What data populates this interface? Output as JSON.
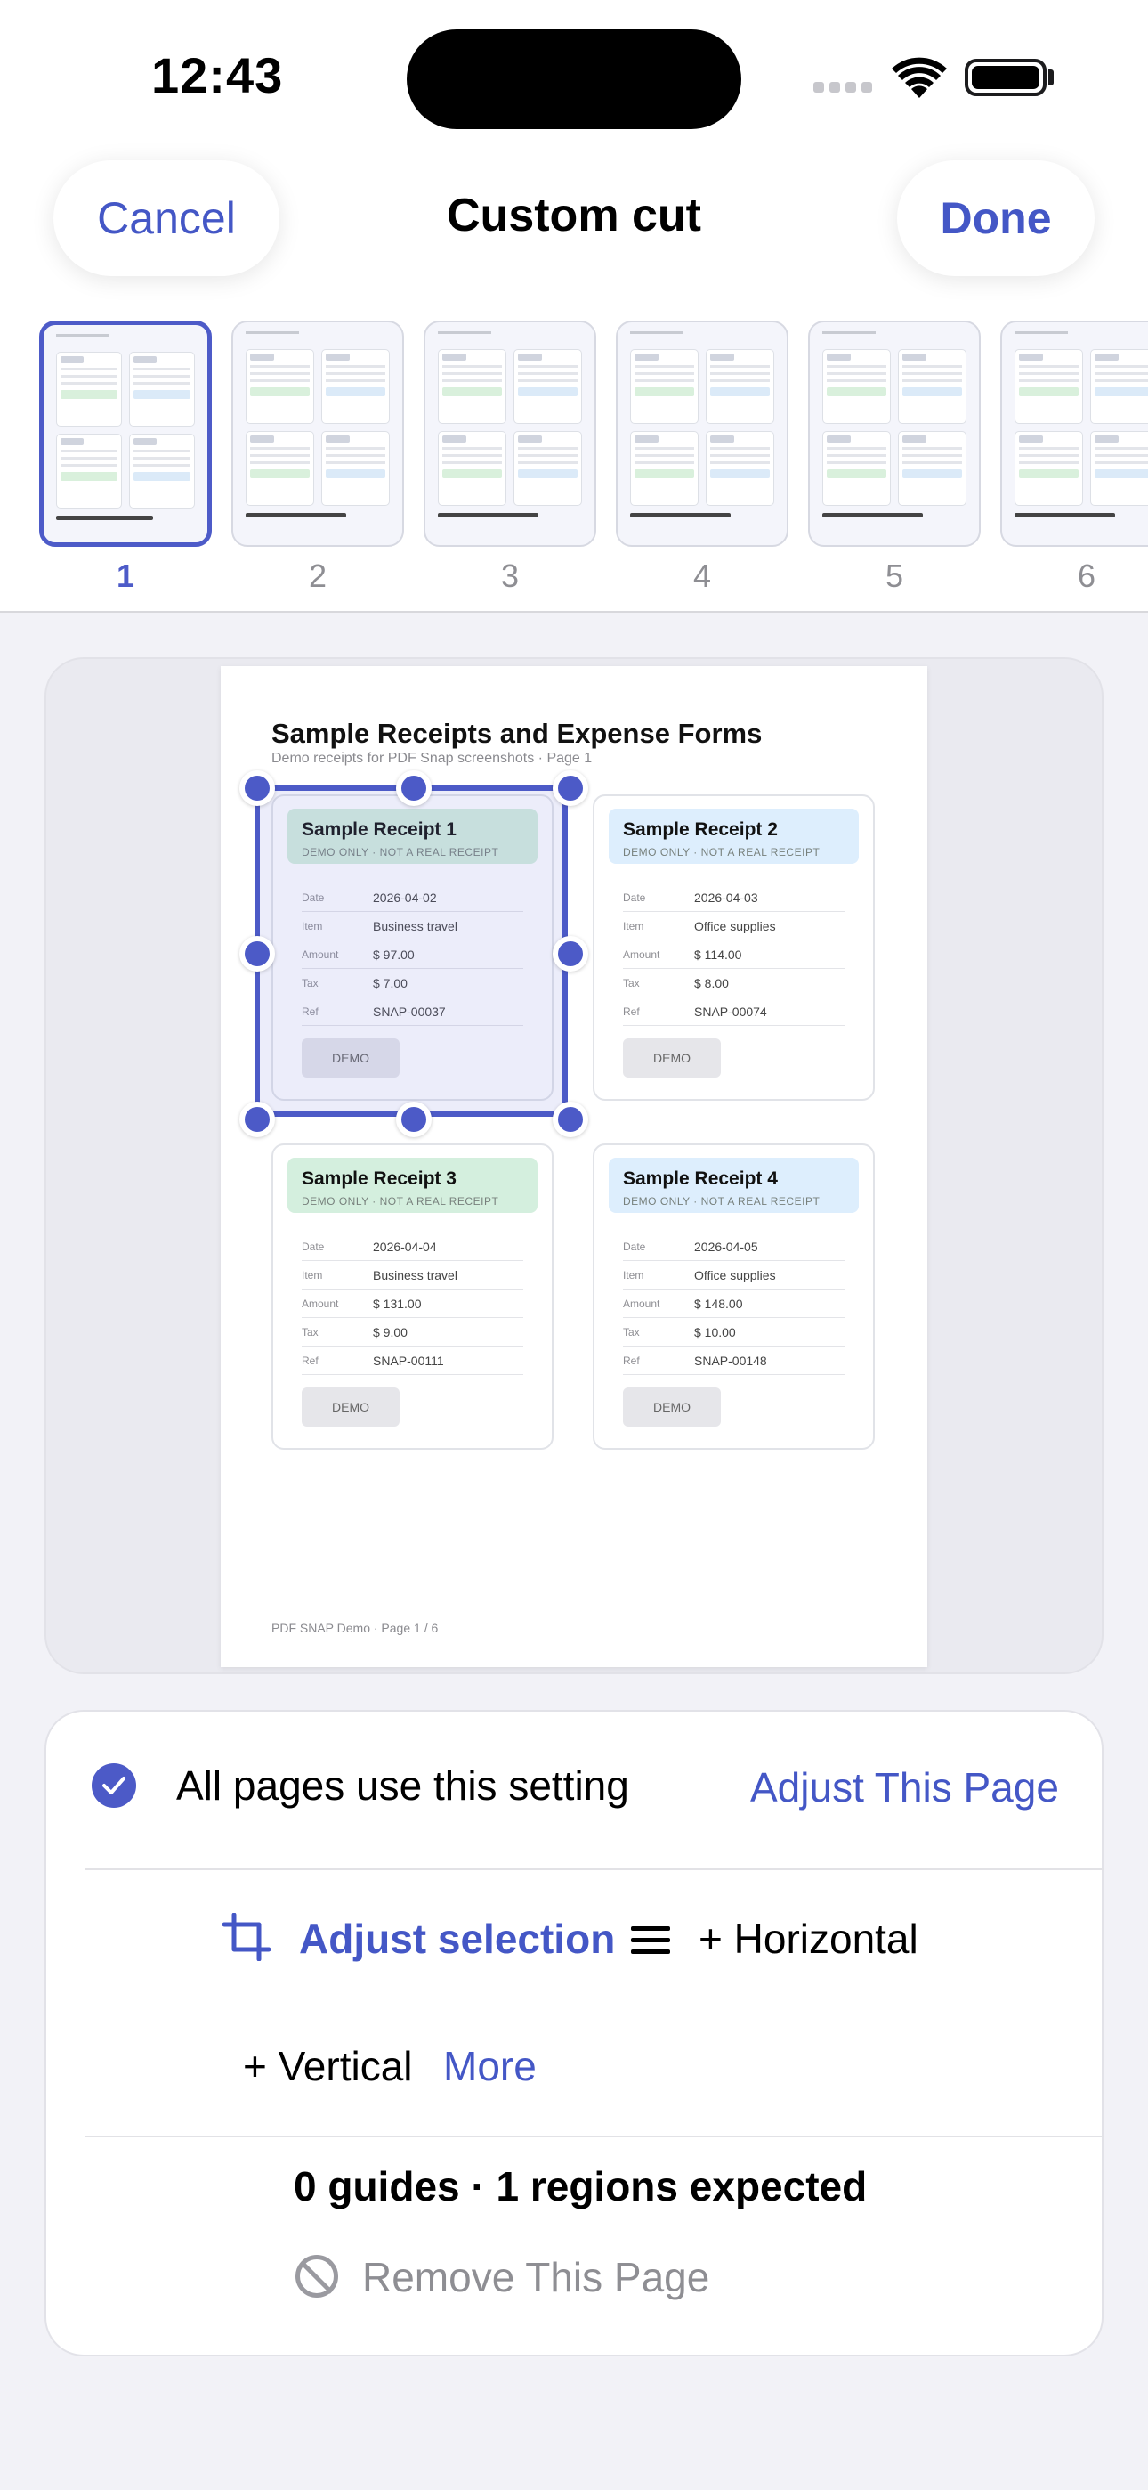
{
  "status": {
    "time": "12:43"
  },
  "nav": {
    "cancel": "Cancel",
    "title": "Custom cut",
    "done": "Done"
  },
  "thumbnails": [
    {
      "label": "1",
      "selected": true
    },
    {
      "label": "2"
    },
    {
      "label": "3"
    },
    {
      "label": "4"
    },
    {
      "label": "5"
    },
    {
      "label": "6"
    }
  ],
  "document": {
    "title": "Sample Receipts and Expense Forms",
    "subtitle": "Demo receipts for PDF Snap screenshots · Page 1",
    "footer": "PDF SNAP Demo · Page 1 / 6",
    "field_labels": [
      "Date",
      "Item",
      "Amount",
      "Tax",
      "Ref"
    ],
    "receipts": [
      {
        "title": "Sample Receipt 1",
        "tag": "DEMO ONLY · NOT A REAL RECEIPT",
        "date": "2026-04-02",
        "item": "Business travel",
        "amount": "$ 97.00",
        "tax": "$ 7.00",
        "ref": "SNAP-00037",
        "button": "DEMO",
        "color": "#d4efde"
      },
      {
        "title": "Sample Receipt 2",
        "tag": "DEMO ONLY · NOT A REAL RECEIPT",
        "date": "2026-04-03",
        "item": "Office supplies",
        "amount": "$ 114.00",
        "tax": "$ 8.00",
        "ref": "SNAP-00074",
        "button": "DEMO",
        "color": "#ddeefd"
      },
      {
        "title": "Sample Receipt 3",
        "tag": "DEMO ONLY · NOT A REAL RECEIPT",
        "date": "2026-04-04",
        "item": "Business travel",
        "amount": "$ 131.00",
        "tax": "$ 9.00",
        "ref": "SNAP-00111",
        "button": "DEMO",
        "color": "#d4efde"
      },
      {
        "title": "Sample Receipt 4",
        "tag": "DEMO ONLY · NOT A REAL RECEIPT",
        "date": "2026-04-05",
        "item": "Office supplies",
        "amount": "$ 148.00",
        "tax": "$ 10.00",
        "ref": "SNAP-00148",
        "button": "DEMO",
        "color": "#ddeefd"
      }
    ]
  },
  "panel": {
    "all_pages": "All pages use this setting",
    "adjust_page": "Adjust This Page",
    "adjust_selection": "Adjust selection",
    "horizontal": "+ Horizontal",
    "vertical": "+ Vertical",
    "more": "More",
    "summary": "0 guides · 1 regions expected",
    "remove": "Remove This Page"
  },
  "colors": {
    "accent": "#4457c6",
    "selection": "#4c5ac7"
  }
}
